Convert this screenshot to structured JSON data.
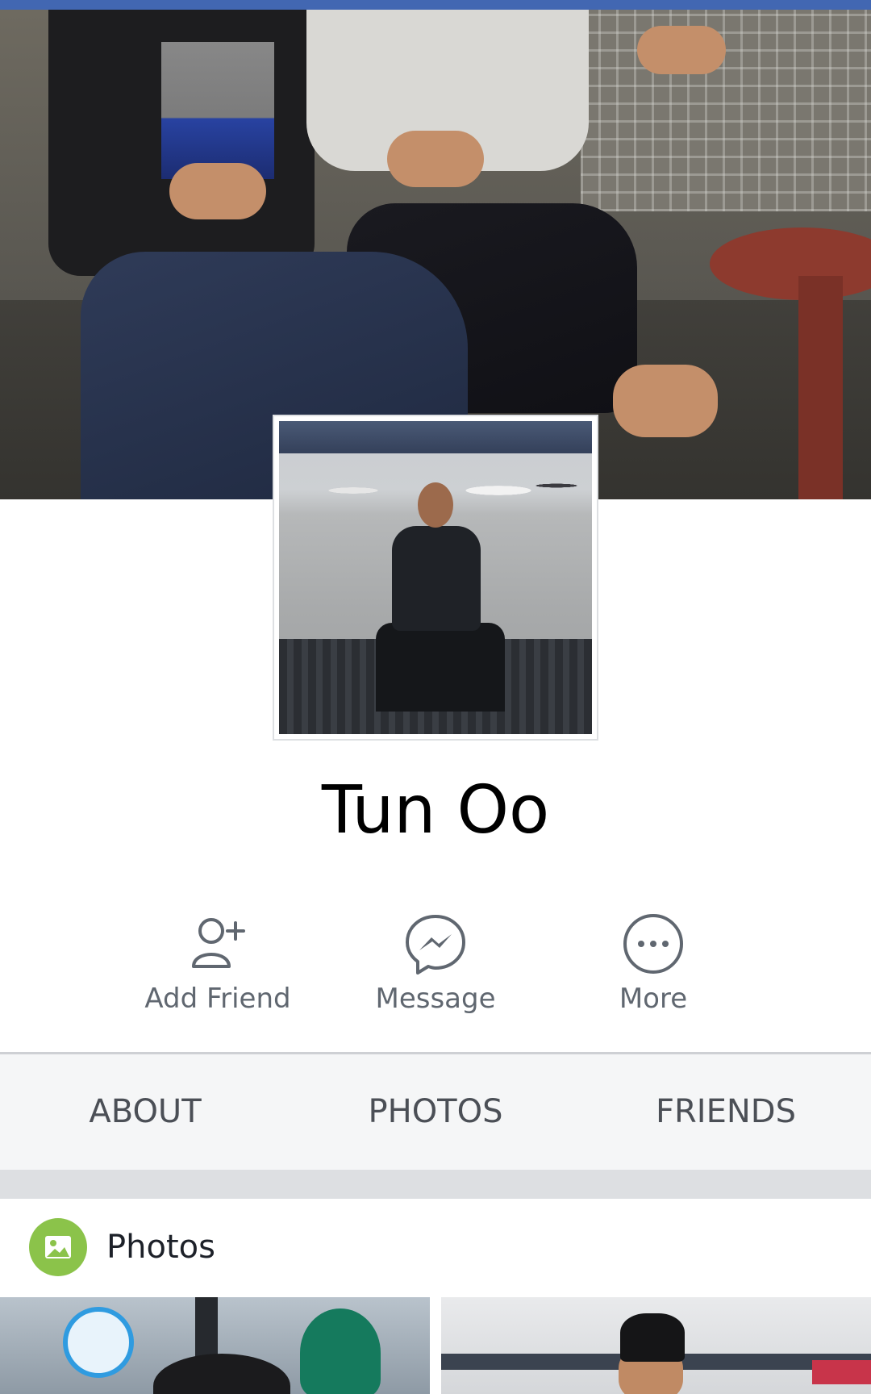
{
  "profile": {
    "name": "Tun Oo"
  },
  "actions": [
    {
      "label": "Add Friend",
      "icon": "add-friend-icon"
    },
    {
      "label": "Message",
      "icon": "messenger-icon"
    },
    {
      "label": "More",
      "icon": "more-icon"
    }
  ],
  "tabs": [
    {
      "label": "ABOUT"
    },
    {
      "label": "PHOTOS"
    },
    {
      "label": "FRIENDS"
    }
  ],
  "photos_section": {
    "title": "Photos",
    "icon": "photos-icon",
    "icon_color": "#8bc34a"
  },
  "colors": {
    "top_bar": "#4267b2",
    "action_text": "#606770",
    "tab_text": "#4b4f56",
    "tab_background": "#f5f6f7"
  }
}
